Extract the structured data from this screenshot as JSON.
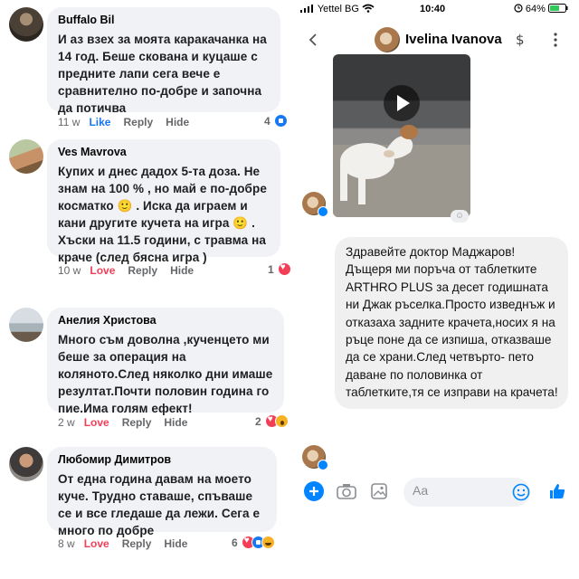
{
  "comments": [
    {
      "name": "Buffalo Bil",
      "text": "И аз взех за моята каракачанка на 14 год. Беше скована и куцаше с предните лапи сега вече е сравнително по-добре и започна да потичва",
      "age": "11 w",
      "reaction_label": "Like",
      "reply": "Reply",
      "hide": "Hide",
      "reaction_count": "4",
      "reactions": [
        "like"
      ],
      "label_color": "#1877f2"
    },
    {
      "name": "Ves Mavrova",
      "text": "Купих и днес дадох 5-та доза. Не знам на 100 % , но май е по-добре косматко 🙂 . Иска да играем и кани другите кучета на игра 🙂 . Хъски на 11.5 години, с травма на краче (след бясна игра )",
      "age": "10 w",
      "reaction_label": "Love",
      "reply": "Reply",
      "hide": "Hide",
      "reaction_count": "1",
      "reactions": [
        "love"
      ],
      "label_color": "#f33e58"
    },
    {
      "name": "Анелия Христова",
      "text": "Много съм доволна ,кученцето ми беше за операция на коляното.След няколко дни имаше резултат.Почти половин година го пие.Има голям ефект!",
      "age": "2 w",
      "reaction_label": "Love",
      "reply": "Reply",
      "hide": "Hide",
      "reaction_count": "2",
      "reactions": [
        "love",
        "wow"
      ],
      "label_color": "#f33e58"
    },
    {
      "name": "Любомир Димитров",
      "text": "От една година давам на моето куче. Трудно ставаше, спъваше се и все гледаше да лежи. Сега е много по добре",
      "age": "8 w",
      "reaction_label": "Love",
      "reply": "Reply",
      "hide": "Hide",
      "reaction_count": "6",
      "reactions": [
        "love",
        "like",
        "haha"
      ],
      "label_color": "#f33e58"
    }
  ],
  "messenger": {
    "status": {
      "carrier": "Yettel BG",
      "time": "10:40",
      "battery": "64%"
    },
    "contact_name": "Ivelina Ivanova",
    "header_icons": [
      "back-icon",
      "dollar-icon",
      "more-icon"
    ],
    "message": "Здравейте доктор Маджаров! Дъщеря ми поръча от таблетките ARTHRO PLUS за десет годишната ни Джак ръселка.Просто изведнъж и отказаха задните крачета,носих я на ръце поне да се изпиша, отказваше да се храни.След четвърто- пето даване по половинка от таблетките,тя се изправи на крачета!",
    "composer_placeholder": "Aa",
    "accent_color": "#0084ff"
  }
}
